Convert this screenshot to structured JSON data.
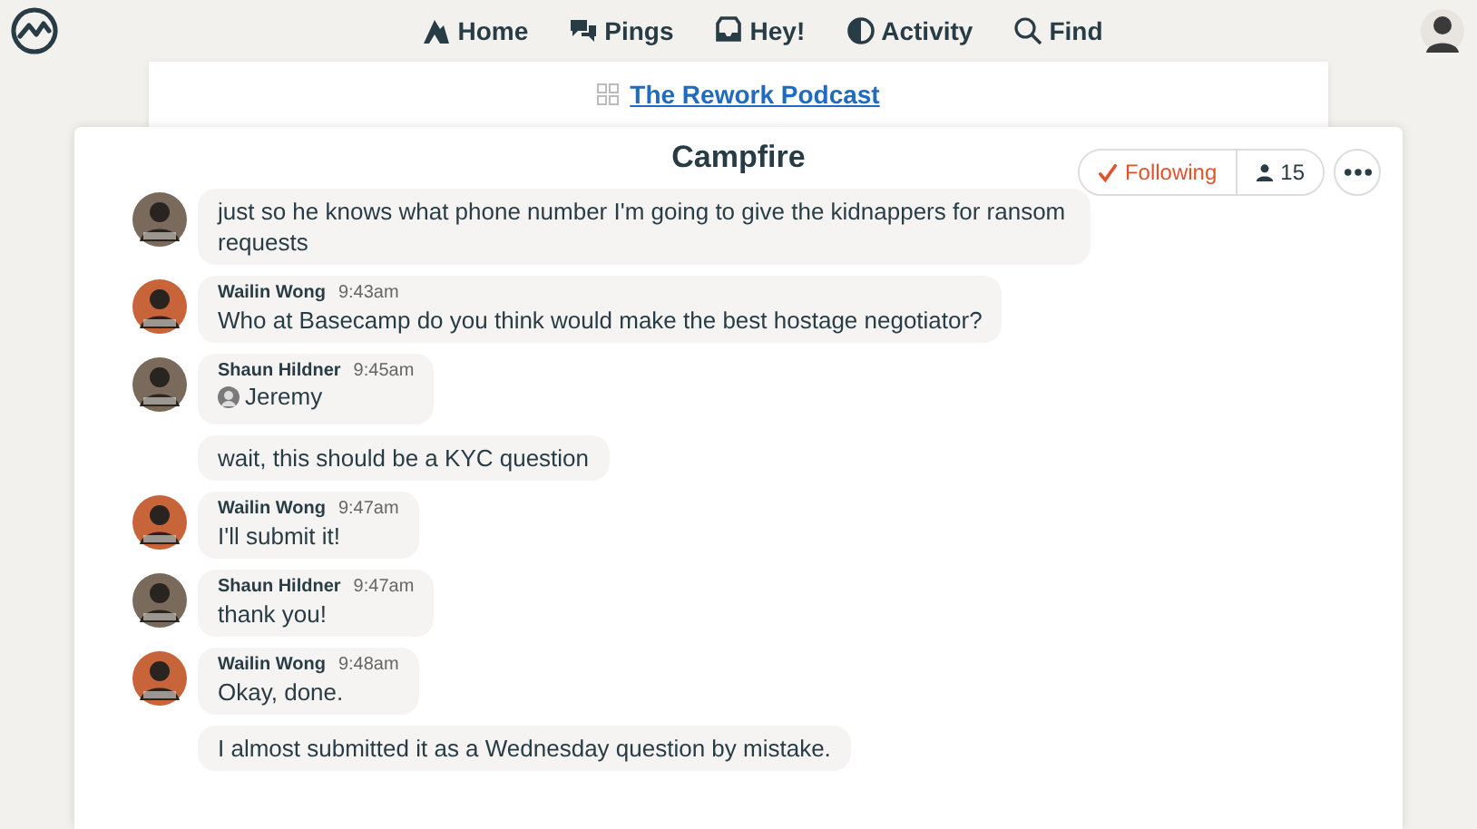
{
  "nav": [
    {
      "label": "Home"
    },
    {
      "label": "Pings"
    },
    {
      "label": "Hey!"
    },
    {
      "label": "Activity"
    },
    {
      "label": "Find"
    }
  ],
  "breadcrumb": {
    "project": "The Rework Podcast"
  },
  "card": {
    "title": "Campfire",
    "following": "Following",
    "subscribers": "15"
  },
  "messages": [
    {
      "kind": "continuation",
      "color": "#7a6a5c",
      "text": "just so he knows what phone number I'm going to give the kidnappers for ransom requests"
    },
    {
      "kind": "message",
      "color": "#c8643a",
      "author": "Wailin Wong",
      "time": "9:43am",
      "text": "Who at Basecamp do you think would make the best hostage negotiator?"
    },
    {
      "kind": "mention",
      "color": "#7a6a5c",
      "author": "Shaun Hildner",
      "time": "9:45am",
      "text": "Jeremy"
    },
    {
      "kind": "continuation",
      "text": "wait, this should be a KYC question"
    },
    {
      "kind": "message",
      "color": "#c8643a",
      "author": "Wailin Wong",
      "time": "9:47am",
      "text": "I'll submit it!"
    },
    {
      "kind": "message",
      "color": "#7a6a5c",
      "author": "Shaun Hildner",
      "time": "9:47am",
      "text": "thank you!"
    },
    {
      "kind": "message",
      "color": "#c8643a",
      "author": "Wailin Wong",
      "time": "9:48am",
      "text": "Okay, done."
    },
    {
      "kind": "continuation",
      "text": "I almost submitted it as a Wednesday question by mistake."
    }
  ]
}
